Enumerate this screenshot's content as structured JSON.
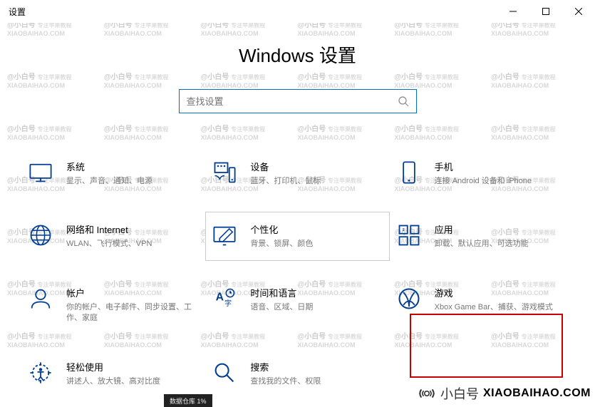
{
  "titlebar": {
    "title": "设置"
  },
  "page": {
    "heading": "Windows 设置"
  },
  "search": {
    "placeholder": "查找设置"
  },
  "categories": [
    {
      "key": "system",
      "title": "系统",
      "desc": "显示、声音、通知、电源"
    },
    {
      "key": "devices",
      "title": "设备",
      "desc": "蓝牙、打印机、鼠标"
    },
    {
      "key": "phone",
      "title": "手机",
      "desc": "连接 Android 设备和 iPhone"
    },
    {
      "key": "network",
      "title": "网络和 Internet",
      "desc": "WLAN、飞行模式、VPN"
    },
    {
      "key": "personalization",
      "title": "个性化",
      "desc": "背景、锁屏、颜色"
    },
    {
      "key": "apps",
      "title": "应用",
      "desc": "卸载、默认应用、可选功能"
    },
    {
      "key": "accounts",
      "title": "帐户",
      "desc": "你的帐户、电子邮件、同步设置、工作、家庭"
    },
    {
      "key": "time",
      "title": "时间和语言",
      "desc": "语音、区域、日期"
    },
    {
      "key": "gaming",
      "title": "游戏",
      "desc": "Xbox Game Bar、捕获、游戏模式"
    },
    {
      "key": "ease",
      "title": "轻松使用",
      "desc": "讲述人、放大镜、高对比度"
    },
    {
      "key": "search",
      "title": "搜索",
      "desc": "查找我的文件、权限"
    }
  ],
  "watermark": {
    "line1": "@小白号",
    "line2": "专注苹果教程",
    "line3": "XIAOBAIHAO.COM"
  },
  "brand": {
    "text1": "小白号",
    "text2": "XIAOBAIHAO.COM"
  },
  "taskbar_frag": "数据仓库    1%"
}
